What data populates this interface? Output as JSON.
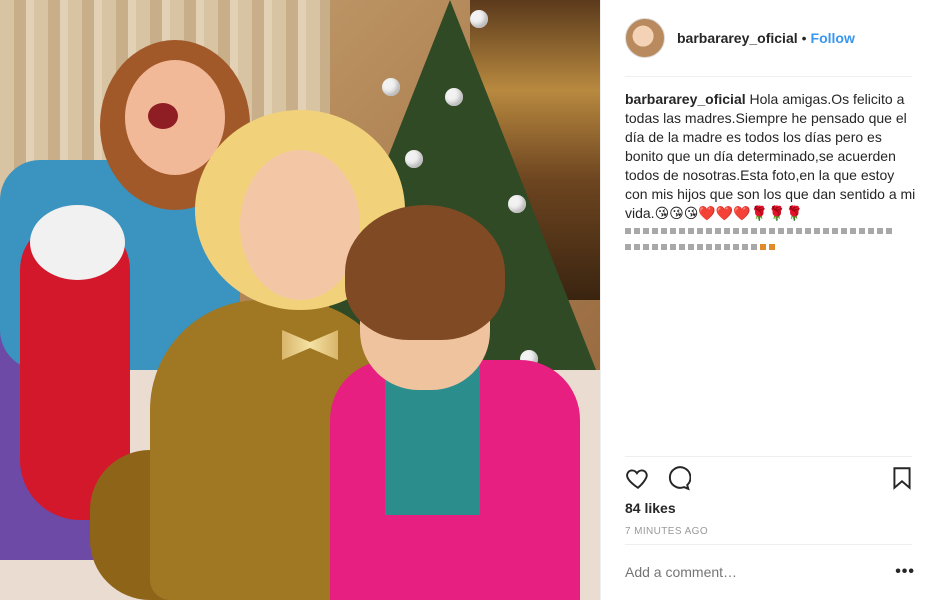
{
  "post": {
    "username": "barbararey_oficial",
    "separator": "•",
    "follow_label": "Follow",
    "caption_user": "barbararey_oficial",
    "caption_text": "Hola amigas.Os felicito a todas las madres.Siempre he pensado que el día de la madre es todos los días pero es bonito que un día determinado,se acuerden todos de nosotras.Esta foto,en la que estoy con mis hijos que son los que dan sentido a mi vida.😘😘😘❤️❤️❤️🌹🌹🌹",
    "likes": "84 likes",
    "timestamp": "7 MINUTES AGO"
  },
  "comment": {
    "placeholder": "Add a comment…",
    "more_label": "•••"
  },
  "icons": {
    "like": "heart-icon",
    "comment": "comment-bubble-icon",
    "save": "bookmark-icon"
  },
  "colors": {
    "follow": "#3897f0",
    "text": "#262626",
    "muted": "#999999"
  }
}
